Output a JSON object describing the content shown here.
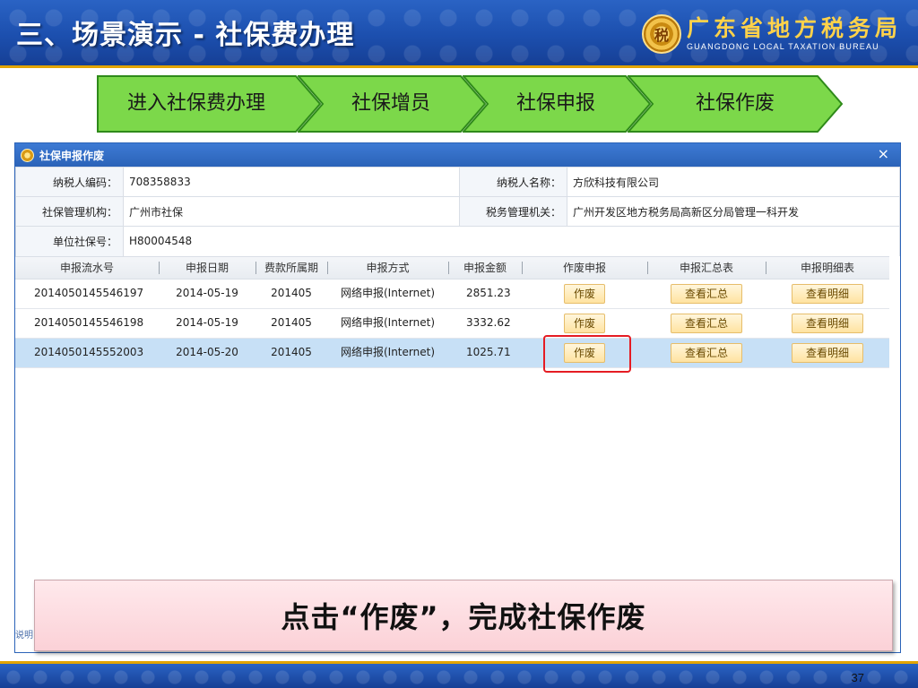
{
  "slide": {
    "title": "三、场景演示 - 社保费办理",
    "brand_cn": "广东省地方税务局",
    "brand_en": "GUANGDONG LOCAL TAXATION BUREAU",
    "page_number": "37"
  },
  "steps": [
    {
      "label": "进入社保费办理"
    },
    {
      "label": "社保增员"
    },
    {
      "label": "社保申报"
    },
    {
      "label": "社保作废"
    }
  ],
  "window": {
    "title": "社保申报作废",
    "close": "×"
  },
  "info": {
    "taxpayer_code_label": "纳税人编码：",
    "taxpayer_code": "708358833",
    "taxpayer_name_label": "纳税人名称：",
    "taxpayer_name": "方欣科技有限公司",
    "ss_agency_label": "社保管理机构：",
    "ss_agency": "广州市社保",
    "tax_agency_label": "税务管理机关：",
    "tax_agency": "广州开发区地方税务局高新区分局管理一科开发",
    "unit_ss_no_label": "单位社保号：",
    "unit_ss_no": "H80004548"
  },
  "grid": {
    "columns": [
      "申报流水号",
      "申报日期",
      "费款所属期",
      "申报方式",
      "申报金额",
      "作废申报",
      "申报汇总表",
      "申报明细表"
    ],
    "rows": [
      {
        "serial": "2014050145546197",
        "date": "2014-05-19",
        "period": "201405",
        "method": "网络申报(Internet)",
        "amount": "2851.23",
        "void_btn": "作废",
        "summary_btn": "查看汇总",
        "detail_btn": "查看明细"
      },
      {
        "serial": "2014050145546198",
        "date": "2014-05-19",
        "period": "201405",
        "method": "网络申报(Internet)",
        "amount": "3332.62",
        "void_btn": "作废",
        "summary_btn": "查看汇总",
        "detail_btn": "查看明细"
      },
      {
        "serial": "2014050145552003",
        "date": "2014-05-20",
        "period": "201405",
        "method": "网络申报(Internet)",
        "amount": "1025.71",
        "void_btn": "作废",
        "summary_btn": "查看汇总",
        "detail_btn": "查看明细"
      }
    ]
  },
  "status_fragment": "说明",
  "callout": {
    "text": "点击“作废”，完成社保作废"
  },
  "colors": {
    "header_blue": "#1c4fae",
    "gold": "#e2a400",
    "step_green": "#7cd84a",
    "highlight_red": "#e51c23",
    "selected_row": "#c7e0f6"
  }
}
